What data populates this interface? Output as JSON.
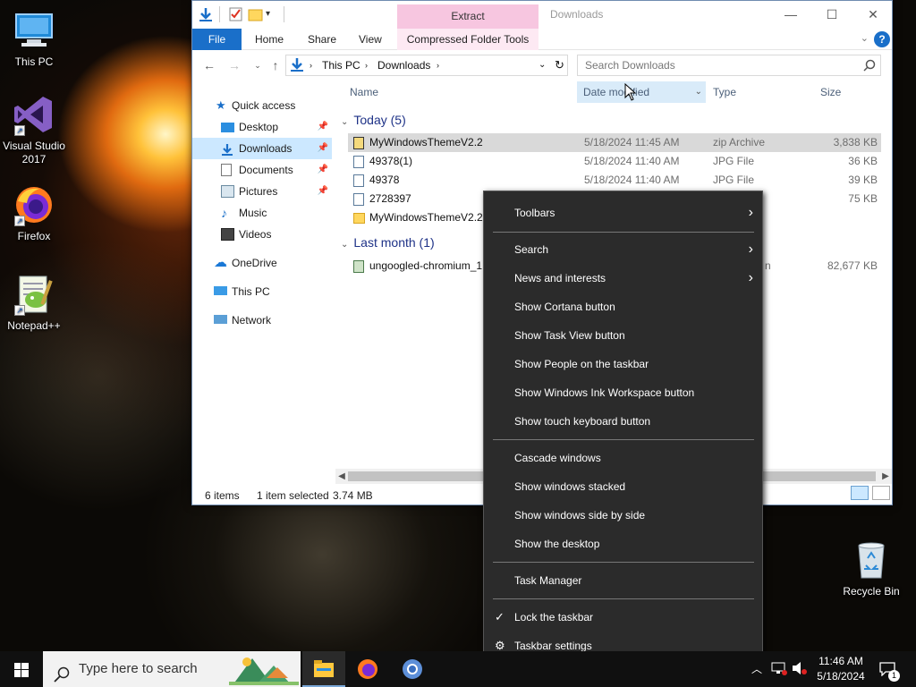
{
  "desktop": {
    "icons": [
      {
        "label": "This PC"
      },
      {
        "label": "Visual Studio 2017"
      },
      {
        "label": "Firefox"
      },
      {
        "label": "Notepad++"
      },
      {
        "label": "Recycle Bin"
      }
    ]
  },
  "explorer": {
    "contextual_group": "Extract",
    "title": "Downloads",
    "tabs": {
      "file": "File",
      "home": "Home",
      "share": "Share",
      "view": "View",
      "compressed": "Compressed Folder Tools"
    },
    "breadcrumb": [
      "This PC",
      "Downloads"
    ],
    "search_placeholder": "Search Downloads",
    "nav": {
      "quick_access": "Quick access",
      "desktop": "Desktop",
      "downloads": "Downloads",
      "documents": "Documents",
      "pictures": "Pictures",
      "music": "Music",
      "videos": "Videos",
      "onedrive": "OneDrive",
      "thispc": "This PC",
      "network": "Network"
    },
    "columns": {
      "name": "Name",
      "date": "Date modified",
      "type": "Type",
      "size": "Size"
    },
    "groups": {
      "today": "Today (5)",
      "last_month": "Last month (1)"
    },
    "files": [
      {
        "name": "MyWindowsThemeV2.2",
        "date": "5/18/2024 11:45 AM",
        "type": "zip Archive",
        "size": "3,838 KB"
      },
      {
        "name": "49378(1)",
        "date": "5/18/2024 11:40 AM",
        "type": "JPG File",
        "size": "36 KB"
      },
      {
        "name": "49378",
        "date": "5/18/2024 11:40 AM",
        "type": "JPG File",
        "size": "39 KB"
      },
      {
        "name": "2728397",
        "date": "",
        "type": "",
        "size": "75 KB"
      },
      {
        "name": "MyWindowsThemeV2.2",
        "date": "",
        "type": "",
        "size": ""
      },
      {
        "name": "ungoogled-chromium_1",
        "date": "",
        "type": "n",
        "size": "82,677 KB"
      }
    ],
    "status": {
      "items": "6 items",
      "selected": "1 item selected",
      "size": "3.74 MB"
    }
  },
  "context_menu": {
    "toolbars": "Toolbars",
    "search": "Search",
    "news": "News and interests",
    "cortana": "Show Cortana button",
    "taskview": "Show Task View button",
    "people": "Show People on the taskbar",
    "ink": "Show Windows Ink Workspace button",
    "touch_kb": "Show touch keyboard button",
    "cascade": "Cascade windows",
    "stacked": "Show windows stacked",
    "side_by_side": "Show windows side by side",
    "show_desktop": "Show the desktop",
    "task_manager": "Task Manager",
    "lock": "Lock the taskbar",
    "settings": "Taskbar settings"
  },
  "taskbar": {
    "search_placeholder": "Type here to search",
    "time": "11:46 AM",
    "date": "5/18/2024",
    "notification_count": "1"
  },
  "colors": {
    "accent": "#1a6fc9",
    "selection": "#cce8ff",
    "menu_bg": "#2b2b2b",
    "ctx_tab": "#f7c6e0"
  }
}
